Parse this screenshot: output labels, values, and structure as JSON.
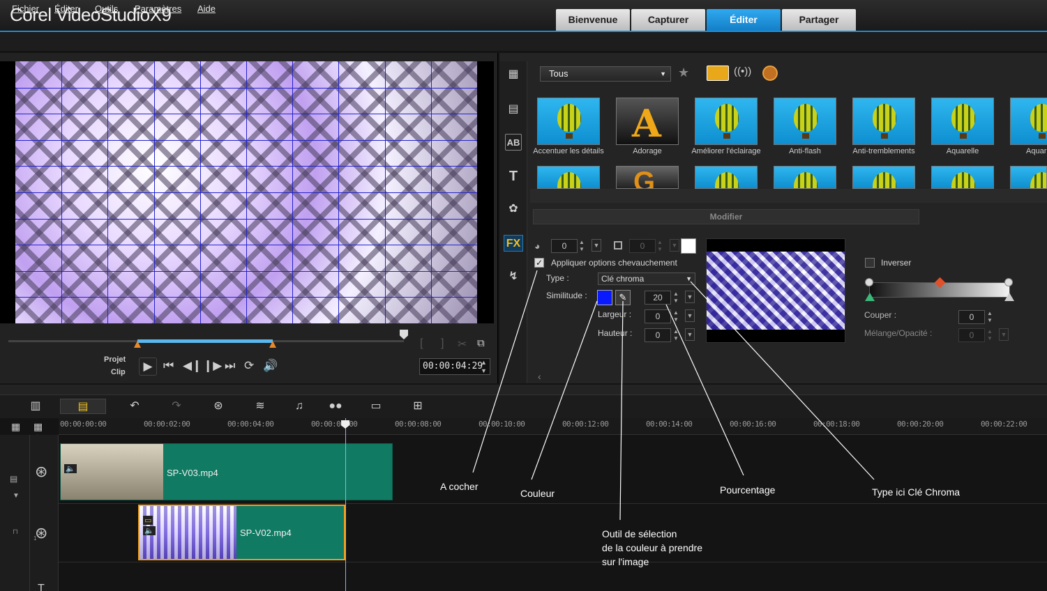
{
  "app": {
    "title": "Corel VideoStudioX9"
  },
  "main_tabs": [
    {
      "label": "Bienvenue"
    },
    {
      "label": "Capturer"
    },
    {
      "label": "Éditer"
    },
    {
      "label": "Partager"
    }
  ],
  "menu": [
    {
      "label": "Fichier"
    },
    {
      "label": "Éditer"
    },
    {
      "label": "Outils"
    },
    {
      "label": "Paramètres"
    },
    {
      "label": "Aide"
    }
  ],
  "player": {
    "project_label": "Projet",
    "clip_label": "Clip",
    "timecode": "00:00:04:29"
  },
  "library": {
    "filter": "Tous",
    "effects": [
      {
        "label": "Accentuer les détails"
      },
      {
        "label": "Adorage"
      },
      {
        "label": "Améliorer l'éclairage"
      },
      {
        "label": "Anti-flash"
      },
      {
        "label": "Anti-tremblements"
      },
      {
        "label": "Aquarelle"
      },
      {
        "label": "Aquar"
      }
    ],
    "side_icons": [
      "media-icon",
      "instant-project-icon",
      "transition-icon",
      "title-icon",
      "graphic-icon",
      "fx-icon",
      "path-icon"
    ]
  },
  "modify": {
    "header": "Modifier",
    "border_value": "0",
    "shadow_value": "0",
    "apply_overlap_label": "Appliquer options chevauchement",
    "apply_overlap_checked": true,
    "type_label": "Type :",
    "type_value": "Clé chroma",
    "similarity_label": "Similitude :",
    "similarity_value": "20",
    "width_label": "Largeur :",
    "width_value": "0",
    "height_label": "Hauteur :",
    "height_value": "0",
    "key_color": "#0a1aff",
    "invert_label": "Inverser",
    "invert_checked": false,
    "crop_label": "Couper :",
    "crop_value": "0",
    "blend_label": "Mélange/Opacité :",
    "blend_value": "0"
  },
  "timeline": {
    "ruler": [
      "00:00:00:00",
      "00:00:02:00",
      "00:00:04:00",
      "00:00:06:00",
      "00:00:08:00",
      "00:00:10:00",
      "00:00:12:00",
      "00:00:14:00",
      "00:00:16:00",
      "00:00:18:00",
      "00:00:20:00",
      "00:00:22:00"
    ],
    "clips": [
      {
        "name": "SP-V03.mp4"
      },
      {
        "name": "SP-V02.mp4"
      }
    ],
    "track_index": "1"
  },
  "annotations": {
    "a_cocher": "A cocher",
    "couleur": "Couleur",
    "pourcentage": "Pourcentage",
    "type_cle": "Type ici Clé Chroma",
    "outil_line1": "Outil de sélection",
    "outil_line2": "de la couleur à prendre",
    "outil_line3": "sur l'image"
  }
}
